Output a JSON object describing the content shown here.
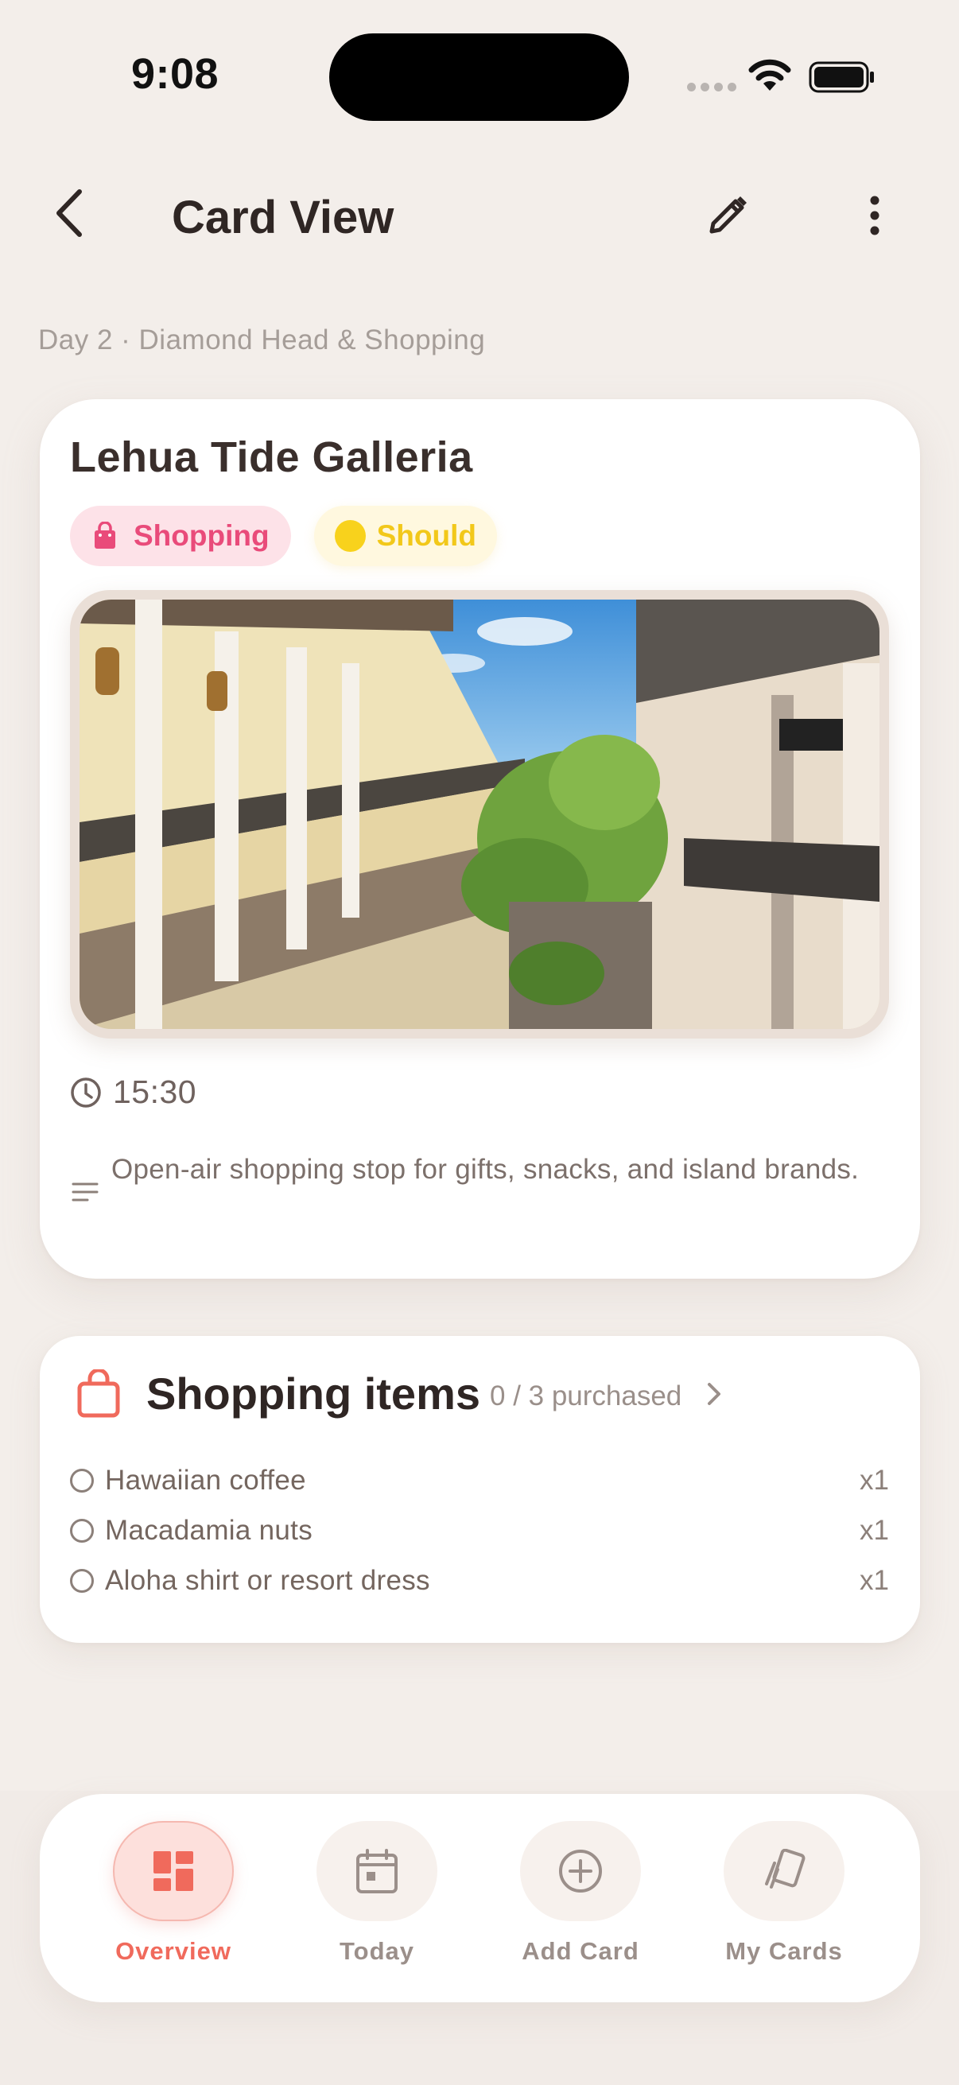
{
  "status_bar": {
    "time": "9:08"
  },
  "topbar": {
    "title": "Card View"
  },
  "breadcrumb": "Day 2 · Diamond Head & Shopping",
  "card": {
    "title": "Lehua Tide Galleria",
    "category_chip": "Shopping",
    "priority_chip": "Should",
    "time": "15:30",
    "notes": "Open-air shopping stop for gifts, snacks, and island brands."
  },
  "shopping": {
    "title": "Shopping items",
    "progress": "0 / 3 purchased",
    "items": [
      {
        "name": "Hawaiian coffee",
        "qty": "x1"
      },
      {
        "name": "Macadamia nuts",
        "qty": "x1"
      },
      {
        "name": "Aloha shirt or resort dress",
        "qty": "x1"
      }
    ]
  },
  "nav": {
    "items": [
      {
        "label": "Overview"
      },
      {
        "label": "Today"
      },
      {
        "label": "Add Card"
      },
      {
        "label": "My Cards"
      }
    ]
  },
  "colors": {
    "accent": "#f06a5c",
    "shopping": "#e94b7a",
    "should": "#f2c81a",
    "background": "#f3eeea"
  }
}
